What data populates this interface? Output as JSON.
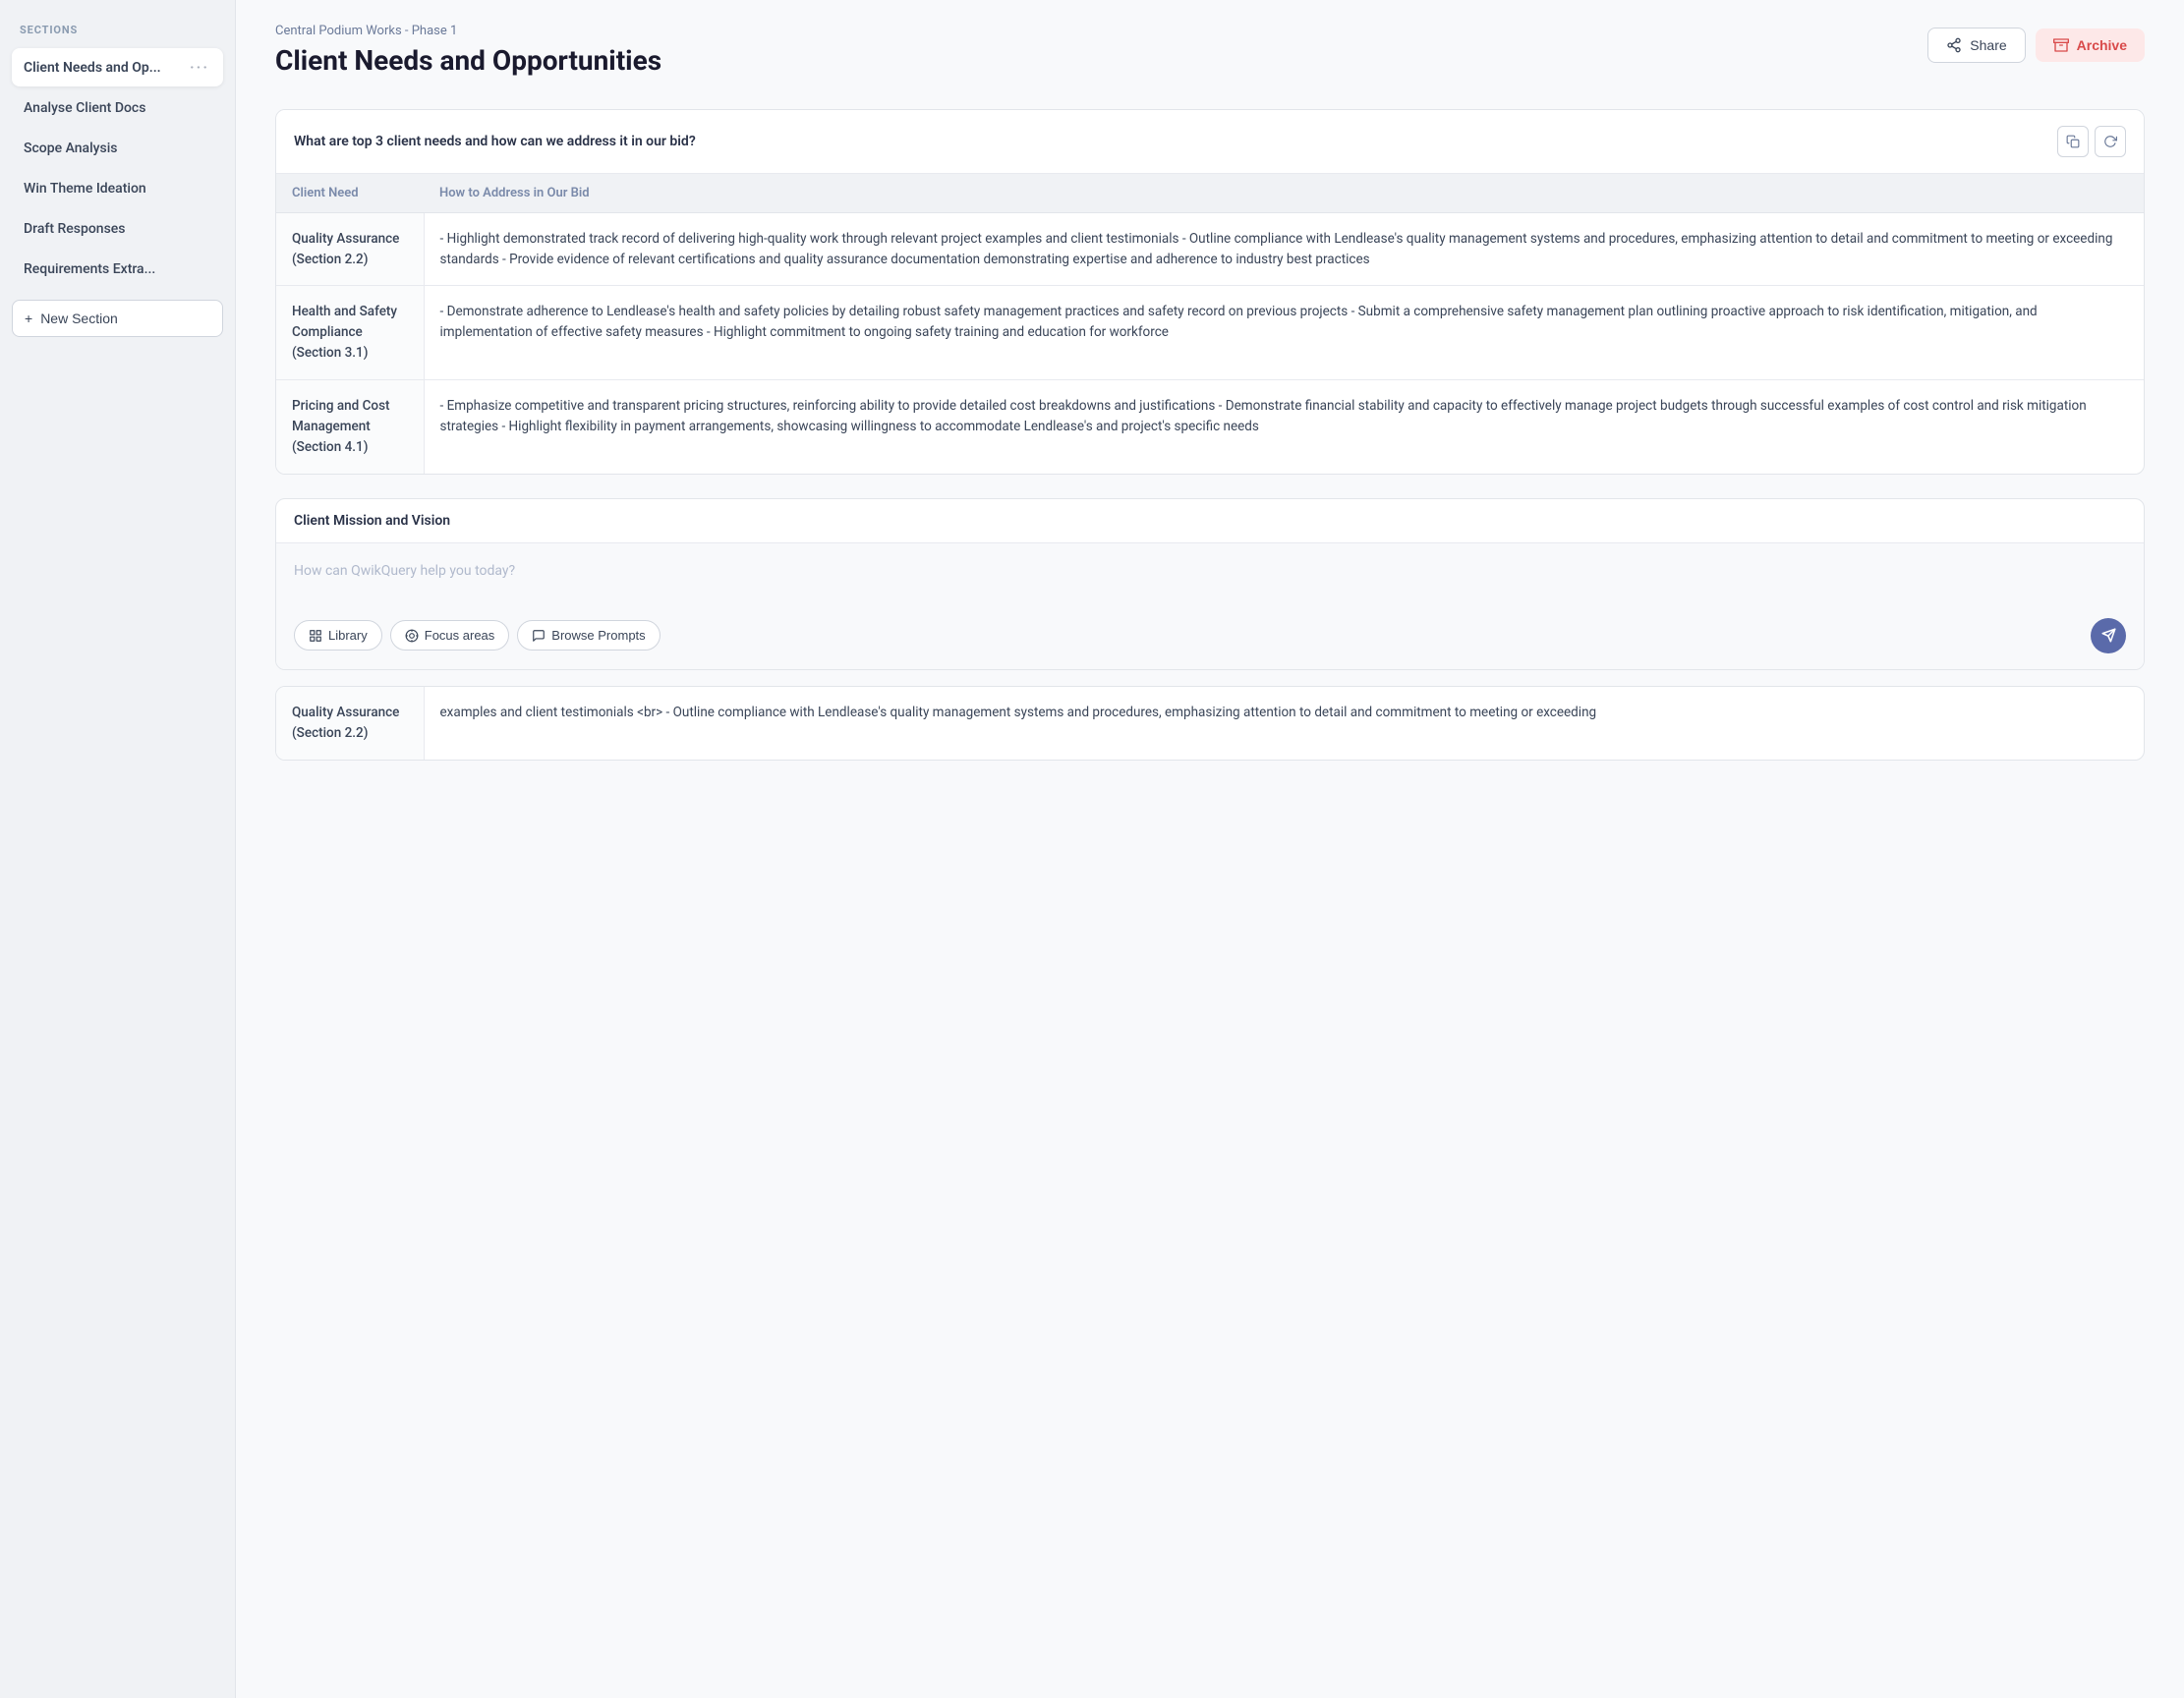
{
  "breadcrumb": "Central Podium Works - Phase 1",
  "page_title": "Client Needs and Opportunities",
  "header_actions": {
    "share_label": "Share",
    "archive_label": "Archive"
  },
  "sidebar": {
    "sections_label": "SECTIONS",
    "items": [
      {
        "id": "client-needs",
        "label": "Client Needs and Op...",
        "active": true
      },
      {
        "id": "analyse-client",
        "label": "Analyse Client Docs",
        "active": false
      },
      {
        "id": "scope-analysis",
        "label": "Scope Analysis",
        "active": false
      },
      {
        "id": "win-theme",
        "label": "Win Theme Ideation",
        "active": false
      },
      {
        "id": "draft-responses",
        "label": "Draft Responses",
        "active": false
      },
      {
        "id": "requirements",
        "label": "Requirements Extra...",
        "active": false
      }
    ],
    "new_section_label": "+ New Section"
  },
  "question_block": {
    "question": "What are top 3 client needs and how can we address it in our bid?",
    "table": {
      "col1_header": "Client Need",
      "col2_header": "How to Address in Our Bid",
      "rows": [
        {
          "need": "Quality Assurance (Section 2.2)",
          "address": "- Highlight demonstrated track record of delivering high-quality work through relevant project examples and client testimonials - Outline compliance with Lendlease's quality management systems and procedures, emphasizing attention to detail and commitment to meeting or exceeding standards - Provide evidence of relevant certifications and quality assurance documentation demonstrating expertise and adherence to industry best practices"
        },
        {
          "need": "Health and Safety Compliance (Section 3.1)",
          "address": "- Demonstrate adherence to Lendlease's health and safety policies by detailing robust safety management practices and safety record on previous projects - Submit a comprehensive safety management plan outlining proactive approach to risk identification, mitigation, and implementation of effective safety measures - Highlight commitment to ongoing safety training and education for workforce"
        },
        {
          "need": "Pricing and Cost Management (Section 4.1)",
          "address": "- Emphasize competitive and transparent pricing structures, reinforcing ability to provide detailed cost breakdowns and justifications - Demonstrate financial stability and capacity to effectively manage project budgets through successful examples of cost control and risk mitigation strategies - Highlight flexibility in payment arrangements, showcasing willingness to accommodate Lendlease's and project's specific needs"
        }
      ]
    }
  },
  "mission_block": {
    "title": "Client Mission and Vision",
    "chat_placeholder": "How can QwikQuery help you today?",
    "toolbar": {
      "library_label": "Library",
      "focus_areas_label": "Focus areas",
      "browse_prompts_label": "Browse Prompts"
    }
  },
  "bottom_partial": {
    "need": "Quality Assurance (Section 2.2)",
    "address": "examples and client testimonials <br> - Outline compliance with Lendlease's quality management systems and procedures, emphasizing attention to detail and commitment to meeting or exceeding"
  }
}
